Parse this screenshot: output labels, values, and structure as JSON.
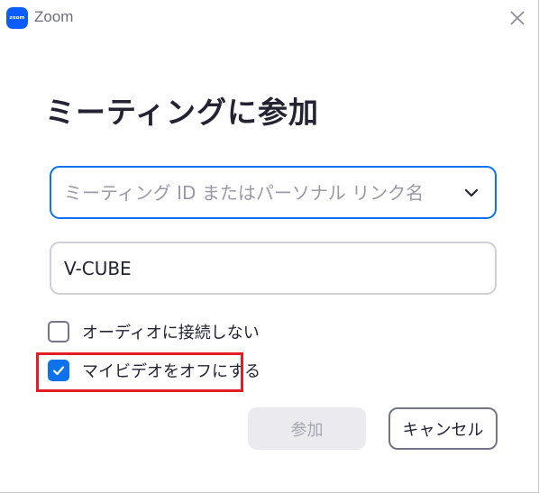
{
  "titlebar": {
    "logo_text": "zoom",
    "title": "Zoom",
    "close_icon": "close-icon"
  },
  "dialog": {
    "heading": "ミーティングに参加",
    "meeting_id_field": {
      "value": "",
      "placeholder": "ミーティング ID またはパーソナル リンク名",
      "dropdown_icon": "chevron-down-icon"
    },
    "name_field": {
      "value": "V-CUBE"
    },
    "options": [
      {
        "label": "オーディオに接続しない",
        "checked": false
      },
      {
        "label": "マイビデオをオフにする",
        "checked": true,
        "highlighted": true
      }
    ],
    "buttons": {
      "join": {
        "label": "参加",
        "enabled": false
      },
      "cancel": {
        "label": "キャンセル",
        "enabled": true
      }
    }
  },
  "colors": {
    "accent": "#0e72ed",
    "logo": "#0b5cff",
    "highlight_box": "#e11d28",
    "disabled_button_bg": "#ebebef"
  }
}
